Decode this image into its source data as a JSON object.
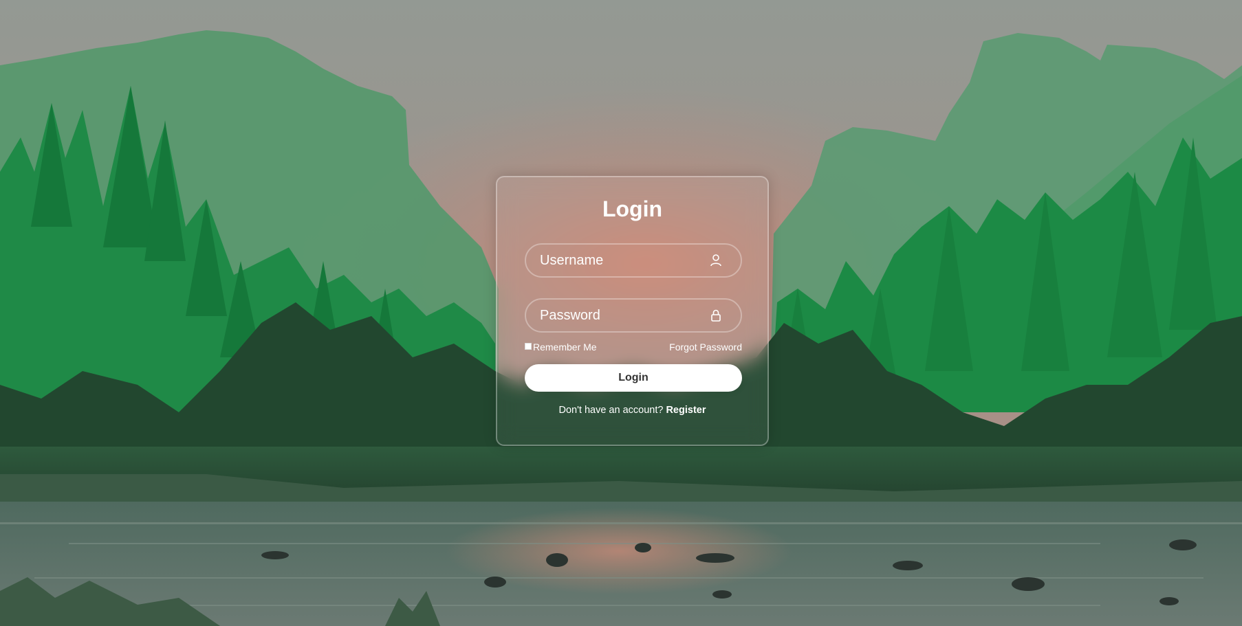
{
  "background": {
    "description_icon": "mountain-forest-river-landscape",
    "colors": {
      "sky_top": "#8f9a92",
      "sky_glow": "#c0877a",
      "cliff": "#4f9a6c",
      "forest": "#1c8a45",
      "dark_forest": "#1d4d2e",
      "river": "#5c6d66"
    }
  },
  "login": {
    "title": "Login",
    "username": {
      "placeholder": "Username",
      "value": "",
      "icon": "user-icon"
    },
    "password": {
      "placeholder": "Password",
      "value": "",
      "icon": "lock-icon"
    },
    "remember_label": "Remember Me",
    "remember_checked": false,
    "forgot_label": "Forgot Password",
    "button_label": "Login",
    "register_prompt": "Don't have an account?",
    "register_label": "Register"
  },
  "theme": {
    "button_bg": "#ffffff",
    "button_text": "#333333",
    "card_border": "rgba(255,255,255,0.32)"
  }
}
